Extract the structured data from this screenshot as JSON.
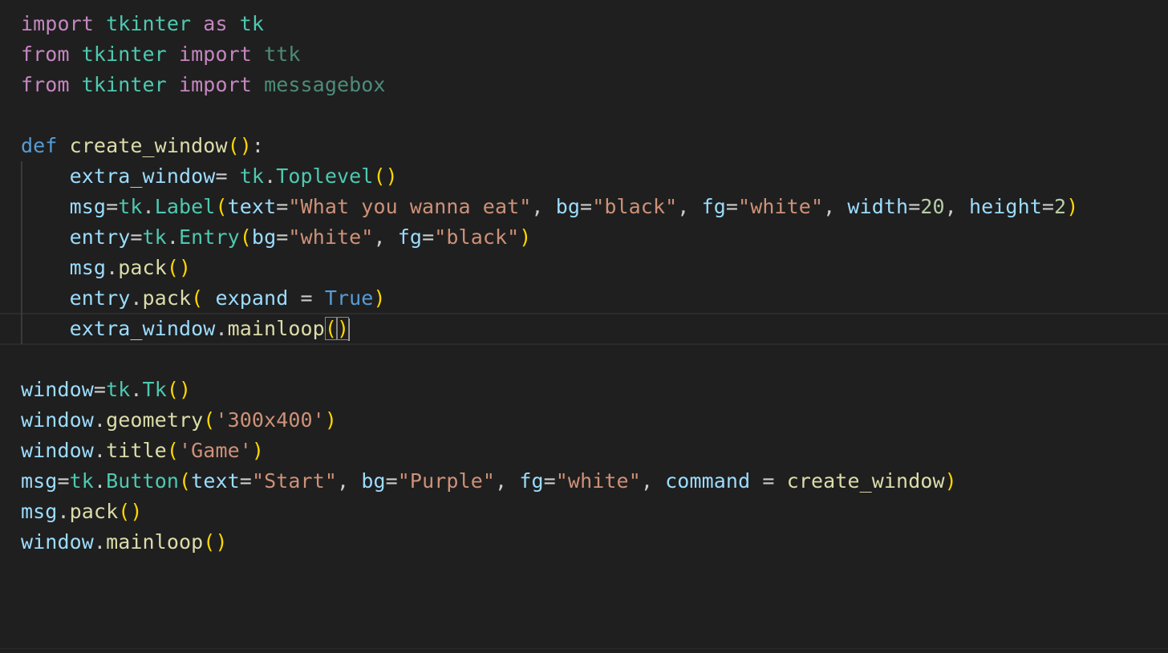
{
  "editor": {
    "language": "python",
    "colors": {
      "background": "#1f1f1f",
      "default": "#cccccc",
      "keyword_import": "#c586c0",
      "keyword_def": "#569cd6",
      "module": "#4ec9b0",
      "function": "#dcdcaa",
      "variable": "#9cdcfe",
      "string": "#ce9178",
      "number": "#b5cea8",
      "constant": "#569cd6",
      "bracket": "#ffd700",
      "unused": "#4d8c79"
    },
    "lines": [
      [
        [
          "import",
          "kw"
        ],
        [
          " ",
          "p"
        ],
        [
          "tkinter",
          "mod"
        ],
        [
          " ",
          "p"
        ],
        [
          "as",
          "kw"
        ],
        [
          " ",
          "p"
        ],
        [
          "tk",
          "mod"
        ]
      ],
      [
        [
          "from",
          "kw"
        ],
        [
          " ",
          "p"
        ],
        [
          "tkinter",
          "mod"
        ],
        [
          " ",
          "p"
        ],
        [
          "import",
          "kw"
        ],
        [
          " ",
          "p"
        ],
        [
          "ttk",
          "unused"
        ]
      ],
      [
        [
          "from",
          "kw"
        ],
        [
          " ",
          "p"
        ],
        [
          "tkinter",
          "mod"
        ],
        [
          " ",
          "p"
        ],
        [
          "import",
          "kw"
        ],
        [
          " ",
          "p"
        ],
        [
          "messagebox",
          "unused"
        ]
      ],
      [],
      [
        [
          "def",
          "def"
        ],
        [
          " ",
          "p"
        ],
        [
          "create_window",
          "fn"
        ],
        [
          "(",
          "br"
        ],
        [
          ")",
          "br"
        ],
        [
          ":",
          "p"
        ]
      ],
      [
        [
          "    ",
          "p"
        ],
        [
          "extra_window",
          "var"
        ],
        [
          "= ",
          "p"
        ],
        [
          "tk",
          "mod"
        ],
        [
          ".",
          "p"
        ],
        [
          "Toplevel",
          "mod"
        ],
        [
          "(",
          "br"
        ],
        [
          ")",
          "br"
        ]
      ],
      [
        [
          "    ",
          "p"
        ],
        [
          "msg",
          "var"
        ],
        [
          "=",
          "p"
        ],
        [
          "tk",
          "mod"
        ],
        [
          ".",
          "p"
        ],
        [
          "Label",
          "mod"
        ],
        [
          "(",
          "br"
        ],
        [
          "text",
          "var"
        ],
        [
          "=",
          "p"
        ],
        [
          "\"What you wanna eat\"",
          "str"
        ],
        [
          ", ",
          "p"
        ],
        [
          "bg",
          "var"
        ],
        [
          "=",
          "p"
        ],
        [
          "\"black\"",
          "str"
        ],
        [
          ", ",
          "p"
        ],
        [
          "fg",
          "var"
        ],
        [
          "=",
          "p"
        ],
        [
          "\"white\"",
          "str"
        ],
        [
          ", ",
          "p"
        ],
        [
          "width",
          "var"
        ],
        [
          "=",
          "p"
        ],
        [
          "20",
          "num"
        ],
        [
          ", ",
          "p"
        ],
        [
          "height",
          "var"
        ],
        [
          "=",
          "p"
        ],
        [
          "2",
          "num"
        ],
        [
          ")",
          "br"
        ]
      ],
      [
        [
          "    ",
          "p"
        ],
        [
          "entry",
          "var"
        ],
        [
          "=",
          "p"
        ],
        [
          "tk",
          "mod"
        ],
        [
          ".",
          "p"
        ],
        [
          "Entry",
          "mod"
        ],
        [
          "(",
          "br"
        ],
        [
          "bg",
          "var"
        ],
        [
          "=",
          "p"
        ],
        [
          "\"white\"",
          "str"
        ],
        [
          ", ",
          "p"
        ],
        [
          "fg",
          "var"
        ],
        [
          "=",
          "p"
        ],
        [
          "\"black\"",
          "str"
        ],
        [
          ")",
          "br"
        ]
      ],
      [
        [
          "    ",
          "p"
        ],
        [
          "msg",
          "var"
        ],
        [
          ".",
          "p"
        ],
        [
          "pack",
          "fn"
        ],
        [
          "(",
          "br"
        ],
        [
          ")",
          "br"
        ]
      ],
      [
        [
          "    ",
          "p"
        ],
        [
          "entry",
          "var"
        ],
        [
          ".",
          "p"
        ],
        [
          "pack",
          "fn"
        ],
        [
          "(",
          "br"
        ],
        [
          " ",
          "p"
        ],
        [
          "expand",
          "var"
        ],
        [
          " = ",
          "p"
        ],
        [
          "True",
          "const"
        ],
        [
          ")",
          "br"
        ]
      ],
      [
        [
          "    ",
          "p"
        ],
        [
          "extra_window",
          "var"
        ],
        [
          ".",
          "p"
        ],
        [
          "mainloop",
          "fn"
        ],
        [
          "(",
          "brm"
        ],
        [
          ")",
          "brm"
        ]
      ],
      [],
      [
        [
          "window",
          "var"
        ],
        [
          "=",
          "p"
        ],
        [
          "tk",
          "mod"
        ],
        [
          ".",
          "p"
        ],
        [
          "Tk",
          "mod"
        ],
        [
          "(",
          "br"
        ],
        [
          ")",
          "br"
        ]
      ],
      [
        [
          "window",
          "var"
        ],
        [
          ".",
          "p"
        ],
        [
          "geometry",
          "fn"
        ],
        [
          "(",
          "br"
        ],
        [
          "'300x400'",
          "str"
        ],
        [
          ")",
          "br"
        ]
      ],
      [
        [
          "window",
          "var"
        ],
        [
          ".",
          "p"
        ],
        [
          "title",
          "fn"
        ],
        [
          "(",
          "br"
        ],
        [
          "'Game'",
          "str"
        ],
        [
          ")",
          "br"
        ]
      ],
      [
        [
          "msg",
          "var"
        ],
        [
          "=",
          "p"
        ],
        [
          "tk",
          "mod"
        ],
        [
          ".",
          "p"
        ],
        [
          "Button",
          "mod"
        ],
        [
          "(",
          "br"
        ],
        [
          "text",
          "var"
        ],
        [
          "=",
          "p"
        ],
        [
          "\"Start\"",
          "str"
        ],
        [
          ", ",
          "p"
        ],
        [
          "bg",
          "var"
        ],
        [
          "=",
          "p"
        ],
        [
          "\"Purple\"",
          "str"
        ],
        [
          ", ",
          "p"
        ],
        [
          "fg",
          "var"
        ],
        [
          "=",
          "p"
        ],
        [
          "\"white\"",
          "str"
        ],
        [
          ", ",
          "p"
        ],
        [
          "command",
          "var"
        ],
        [
          " = ",
          "p"
        ],
        [
          "create_window",
          "fn"
        ],
        [
          ")",
          "br"
        ]
      ],
      [
        [
          "msg",
          "var"
        ],
        [
          ".",
          "p"
        ],
        [
          "pack",
          "fn"
        ],
        [
          "(",
          "br"
        ],
        [
          ")",
          "br"
        ]
      ],
      [
        [
          "window",
          "var"
        ],
        [
          ".",
          "p"
        ],
        [
          "mainloop",
          "fn"
        ],
        [
          "(",
          "br"
        ],
        [
          ")",
          "br"
        ]
      ]
    ],
    "current_line": 10
  }
}
